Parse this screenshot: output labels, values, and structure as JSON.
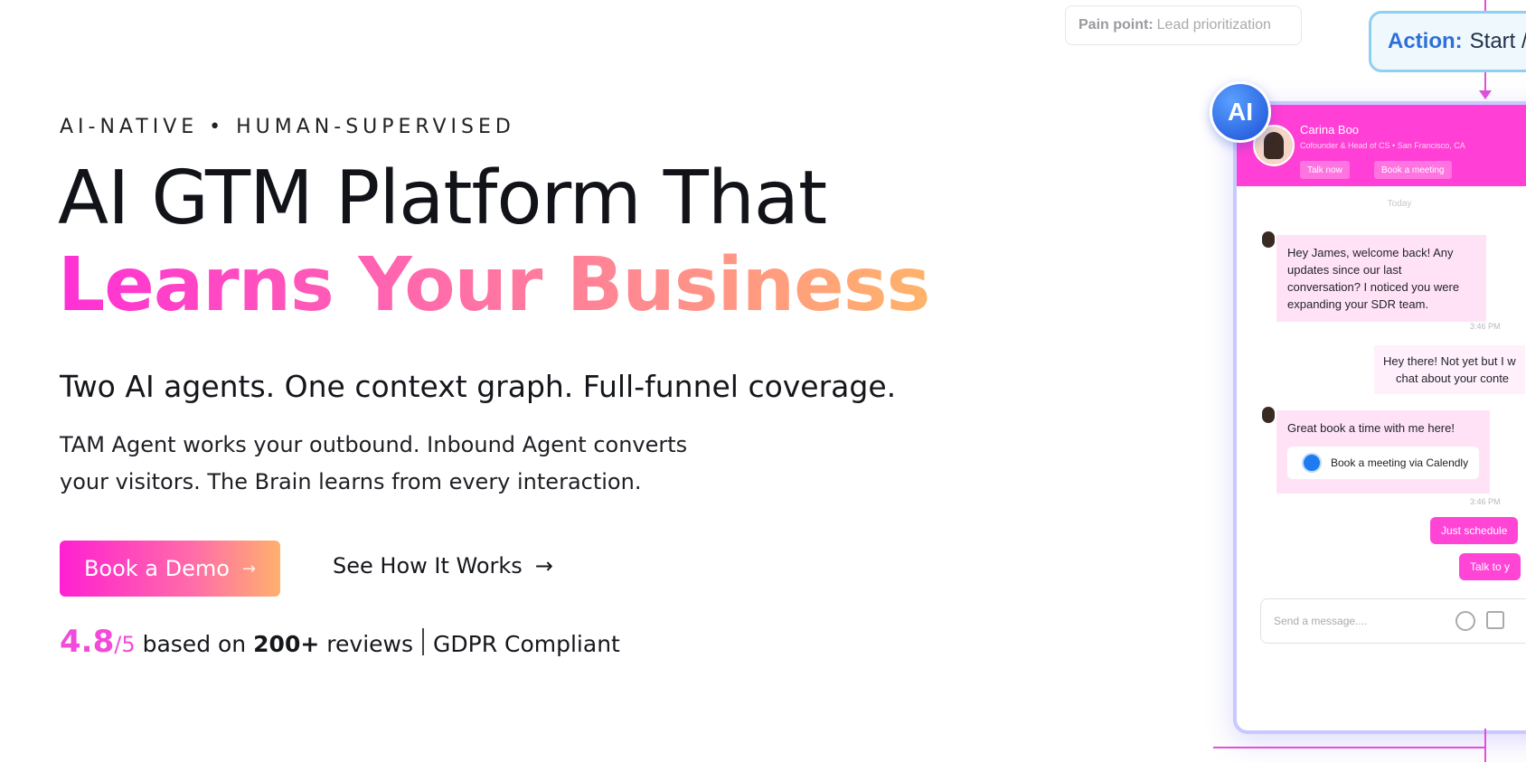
{
  "hero": {
    "eyebrow": "AI-NATIVE • HUMAN-SUPERVISED",
    "title_line1": "AI GTM Platform That",
    "title_line2": "Learns Your Business",
    "subhead": "Two AI agents. One context graph. Full-funnel coverage.",
    "body": "TAM Agent works your outbound. Inbound Agent converts your visitors. The Brain learns from every interaction.",
    "cta_primary": "Book a Demo",
    "cta_primary_arrow": "→",
    "cta_secondary": "See How It Works",
    "cta_secondary_arrow": "→"
  },
  "rating": {
    "score": "4.8",
    "out_of": "/5",
    "text_based": "based on",
    "count": "200+",
    "text_reviews": "reviews",
    "compliance": "GDPR Compliant"
  },
  "visual": {
    "pain_label": "Pain point:",
    "pain_value": "Lead prioritization",
    "action_label": "Action:",
    "action_value": "Start /",
    "ai_badge": "AI",
    "agent_name": "Carina Boo",
    "agent_role": "Cofounder & Head of CS • San Francisco, CA",
    "btn_talk": "Talk now",
    "btn_book": "Book a meeting",
    "today": "Today",
    "msg1": "Hey James, welcome back! Any updates since our last conversation? I noticed you were expanding your SDR team.",
    "time1": "3:46 PM",
    "msg2_line1": "Hey there! Not yet but I w",
    "msg2_line2": "chat about your conte",
    "msg3": "Great book a time with me here!",
    "calendly": "Book a meeting via Calendly",
    "time2": "3:46 PM",
    "pill1": "Just schedule",
    "pill2": "Talk to y",
    "compose_placeholder": "Send a message...."
  },
  "colors": {
    "accent_pink": "#ff2fd6",
    "accent_peach": "#ffb36a",
    "action_blue": "#2f6fd8"
  }
}
